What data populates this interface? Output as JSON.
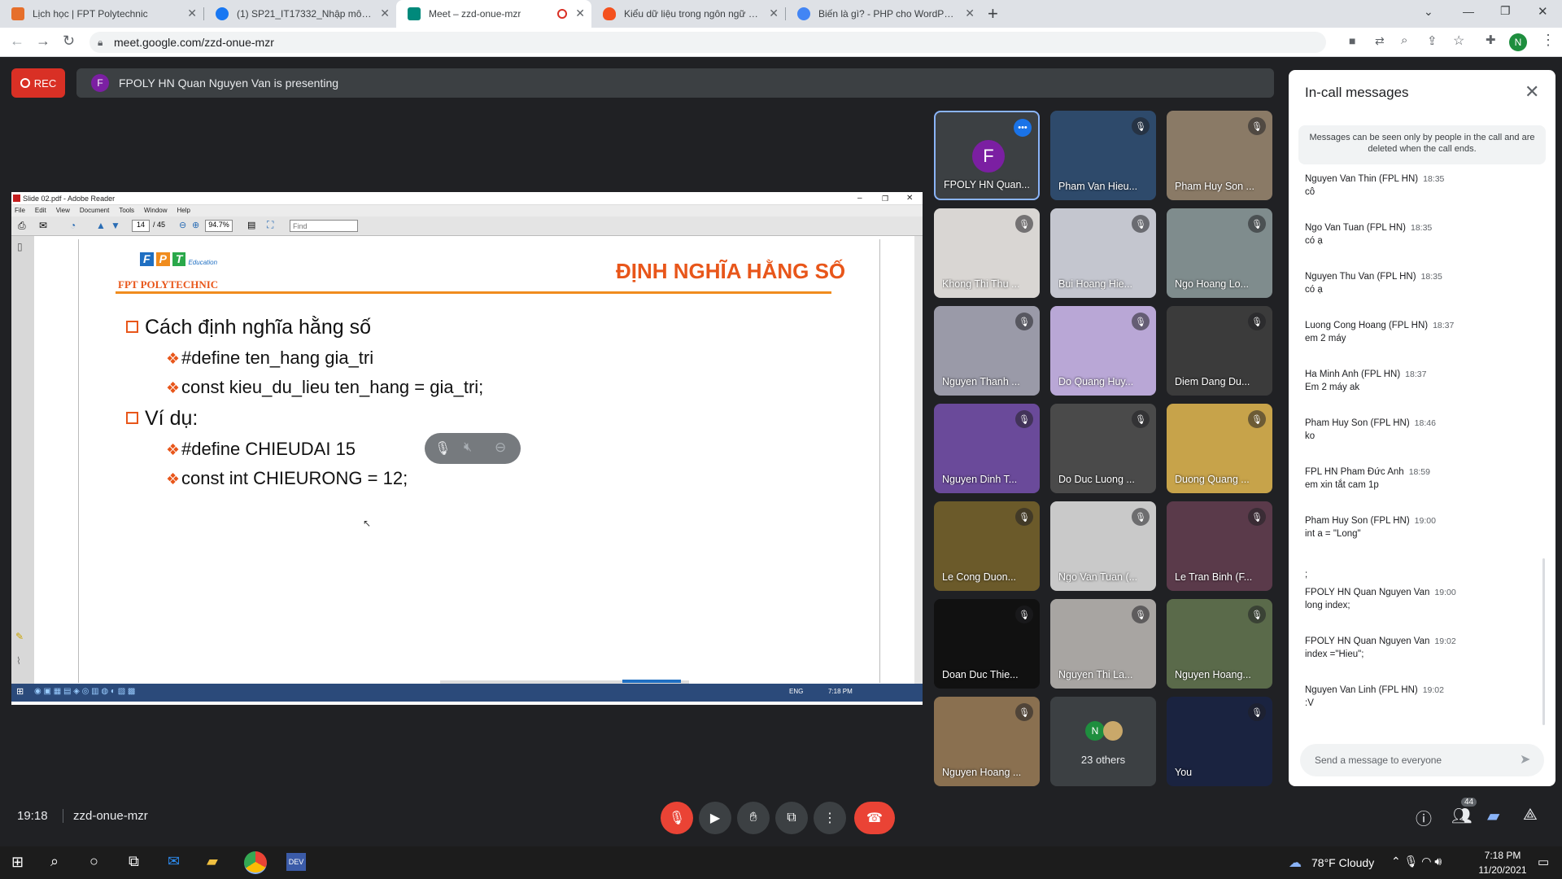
{
  "browser": {
    "tabs": [
      {
        "label": "Lịch học | FPT Polytechnic",
        "fav": "#e66f2b"
      },
      {
        "label": "(1) SP21_IT17332_Nhập môn lập t...",
        "fav": "#1877f2"
      },
      {
        "label": "Meet – zzd-onue-mzr",
        "fav": "#00897b",
        "active": true
      },
      {
        "label": "Kiểu dữ liệu trong ngôn ngữ C và...",
        "fav": "#f4511e"
      },
      {
        "label": "Biến là gì? - PHP cho WordPress ...",
        "fav": "#4285f4"
      }
    ],
    "url": "meet.google.com/zzd-onue-mzr",
    "profile_initial": "N"
  },
  "meet": {
    "rec_label": "REC",
    "presenter_initial": "F",
    "presenting_text": "FPOLY HN Quan Nguyen Van is presenting",
    "time": "19:18",
    "meeting_code": "zzd-onue-mzr",
    "people_count": "44"
  },
  "acrobat": {
    "title": "Slide 02.pdf - Adobe Reader",
    "menu": [
      "File",
      "Edit",
      "View",
      "Document",
      "Tools",
      "Window",
      "Help"
    ],
    "page_current": "14",
    "page_total": "/ 45",
    "zoom": "94.7%",
    "find_placeholder": "Find",
    "taskbar_lang": "ENG",
    "taskbar_time": "7:18 PM"
  },
  "slide": {
    "logo_text": "FPT",
    "logo_sub": "Education",
    "school": "FPT POLYTECHNIC",
    "title": "ĐỊNH NGHĨA HẰNG SỐ",
    "h1": "Cách định nghĩa hằng số",
    "b1": "#define ten_hang gia_tri",
    "b2": "const kieu_du_lieu ten_hang  = gia_tri;",
    "h2": "Ví dụ:",
    "b3": "#define CHIEUDAI 15",
    "b4": "const int CHIEURONG = 12;"
  },
  "participants": [
    {
      "name": "FPOLY HN Quan...",
      "bg": "#3c4043",
      "initial": "F",
      "highlight": true
    },
    {
      "name": "Pham Van Hieu...",
      "bg": "#2e4a6b"
    },
    {
      "name": "Pham Huy Son ...",
      "bg": "#8a7a66"
    },
    {
      "name": "Khong Thi Thu ...",
      "bg": "#d9d6d3"
    },
    {
      "name": "Bui Hoang Hie...",
      "bg": "#c4c6cf"
    },
    {
      "name": "Ngo Hoang Lo...",
      "bg": "#7f8c8d"
    },
    {
      "name": "Nguyen Thanh ...",
      "bg": "#9a9aa8"
    },
    {
      "name": "Do Quang Huy...",
      "bg": "#b9a7d6"
    },
    {
      "name": "Diem Dang Du...",
      "bg": "#3b3b3b"
    },
    {
      "name": "Nguyen Dinh T...",
      "bg": "#6a4a9a"
    },
    {
      "name": "Do Duc Luong ...",
      "bg": "#4a4a4a"
    },
    {
      "name": "Duong Quang ...",
      "bg": "#c7a34a"
    },
    {
      "name": "Le Cong Duon...",
      "bg": "#6b5a2a"
    },
    {
      "name": "Ngo Van Tuan (...",
      "bg": "#c9c9c9"
    },
    {
      "name": "Le Tran Binh (F...",
      "bg": "#5a3a4a"
    },
    {
      "name": "Doan Duc Thie...",
      "bg": "#111111"
    },
    {
      "name": "Nguyen Thi La...",
      "bg": "#a8a5a2"
    },
    {
      "name": "Nguyen Hoang...",
      "bg": "#5a6a4a"
    },
    {
      "name": "Nguyen Hoang ...",
      "bg": "#8a7050"
    },
    {
      "name": "23 others",
      "bg": "#3c4043",
      "others": true
    },
    {
      "name": "You",
      "bg": "#1a2340"
    }
  ],
  "panel": {
    "title": "In-call messages",
    "note": "Messages can be seen only by people in the call and are deleted when the call ends.",
    "messages": [
      {
        "who": "Nguyen Van Thin (FPL HN)",
        "time": "18:35",
        "text": "cô"
      },
      {
        "who": "Ngo Van Tuan (FPL HN)",
        "time": "18:35",
        "text": "có ạ"
      },
      {
        "who": "Nguyen Thu Van (FPL HN)",
        "time": "18:35",
        "text": "có ạ"
      },
      {
        "who": "Luong Cong Hoang (FPL HN)",
        "time": "18:37",
        "text": "em 2 máy"
      },
      {
        "who": "Ha Minh Anh (FPL HN)",
        "time": "18:37",
        "text": "Em 2 máy ak"
      },
      {
        "who": "Pham Huy Son (FPL HN)",
        "time": "18:46",
        "text": "ko"
      },
      {
        "who": "FPL HN Pham Đức Anh",
        "time": "18:59",
        "text": "em xin tắt cam 1p"
      },
      {
        "who": "Pham Huy Son (FPL HN)",
        "time": "19:00",
        "text": "int a = \"Long\""
      },
      {
        "who": "FPOLY HN Quan Nguyen Van",
        "time": "19:00",
        "text": "long index;"
      },
      {
        "who": "FPOLY HN Quan Nguyen Van",
        "time": "19:02",
        "text": "index =\"Hieu\";"
      },
      {
        "who": "Nguyen Van Linh (FPL HN)",
        "time": "19:02",
        "text": ":V"
      }
    ],
    "extra_line": ";",
    "input_placeholder": "Send a message to everyone"
  },
  "windows": {
    "weather": "78°F  Cloudy",
    "time": "7:18 PM",
    "date": "11/20/2021"
  }
}
